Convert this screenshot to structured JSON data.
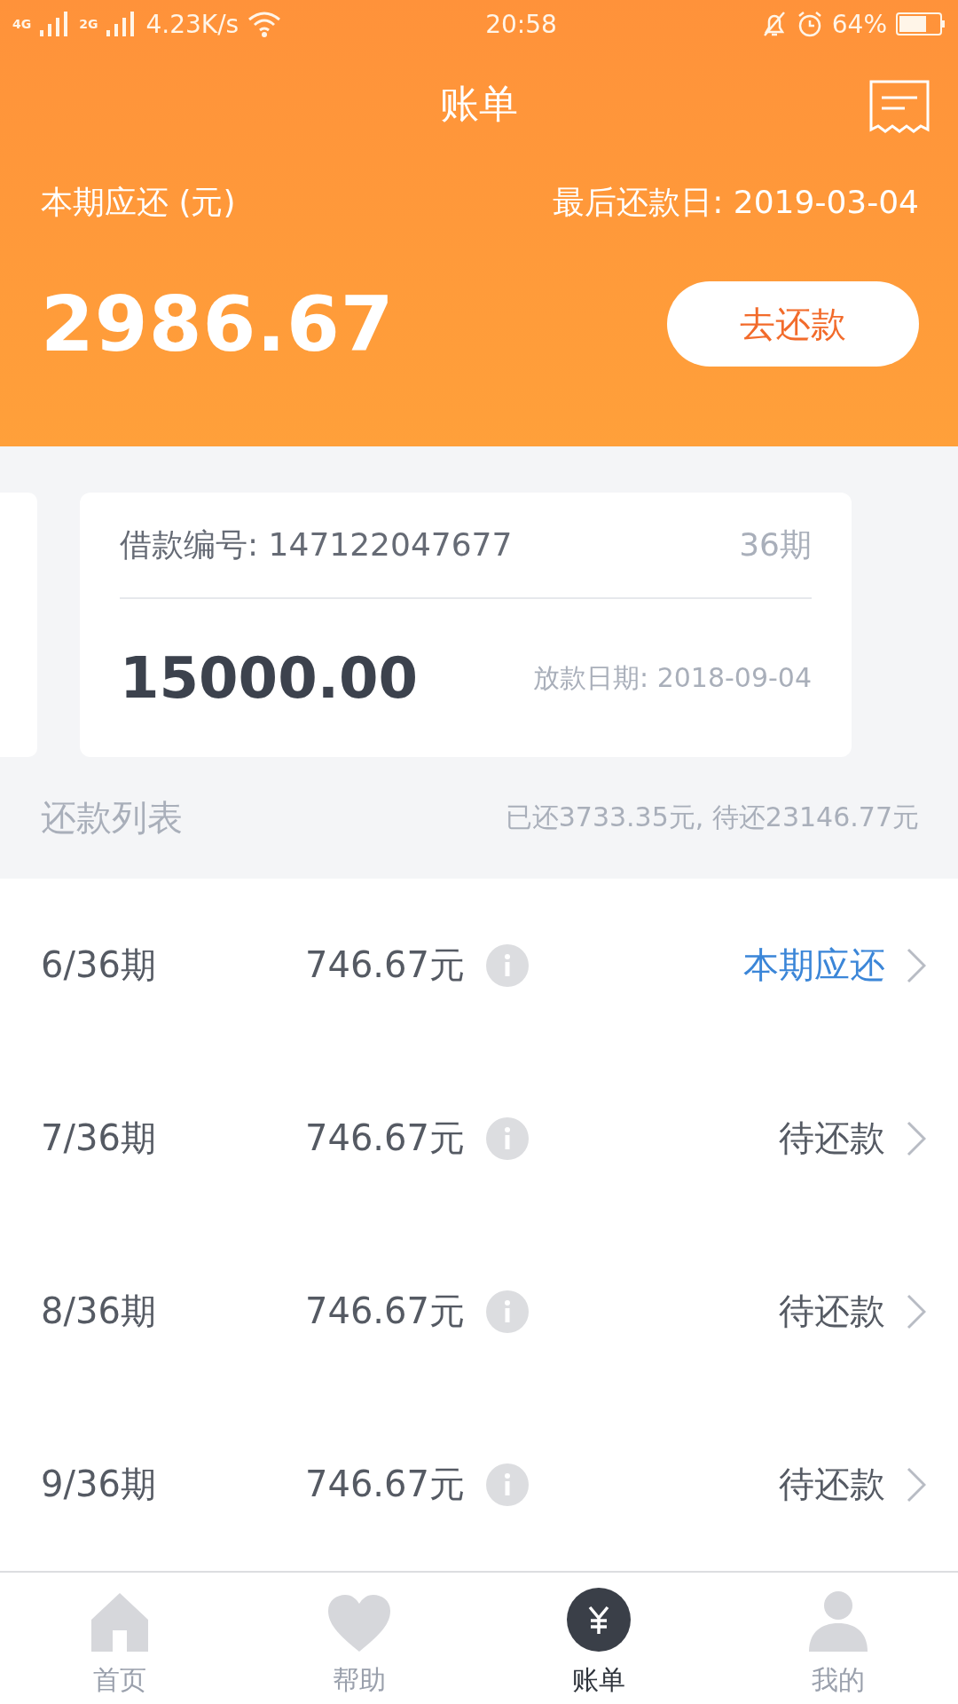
{
  "status_bar": {
    "network_1": "4G",
    "network_2": "2G",
    "speed": "4.23K/s",
    "time": "20:58",
    "battery": "64%"
  },
  "header": {
    "title": "账单",
    "due_label": "本期应还 (元)",
    "due_date": "最后还款日: 2019-03-04",
    "amount": "2986.67",
    "pay_button": "去还款"
  },
  "loan_card": {
    "loan_no": "借款编号: 147122047677",
    "periods": "36期",
    "principal": "15000.00",
    "issue_date": "放款日期: 2018-09-04"
  },
  "repayment_list": {
    "title": "还款列表",
    "summary": "已还3733.35元, 待还23146.77元",
    "rows": [
      {
        "period": "6/36期",
        "amount": "746.67元",
        "status": "本期应还",
        "current": true
      },
      {
        "period": "7/36期",
        "amount": "746.67元",
        "status": "待还款",
        "current": false
      },
      {
        "period": "8/36期",
        "amount": "746.67元",
        "status": "待还款",
        "current": false
      },
      {
        "period": "9/36期",
        "amount": "746.67元",
        "status": "待还款",
        "current": false
      }
    ]
  },
  "tab_bar": [
    {
      "label": "首页",
      "kind": "home",
      "selected": false
    },
    {
      "label": "帮助",
      "kind": "help",
      "selected": false
    },
    {
      "label": "账单",
      "kind": "bill",
      "selected": true
    },
    {
      "label": "我的",
      "kind": "me",
      "selected": false
    }
  ]
}
